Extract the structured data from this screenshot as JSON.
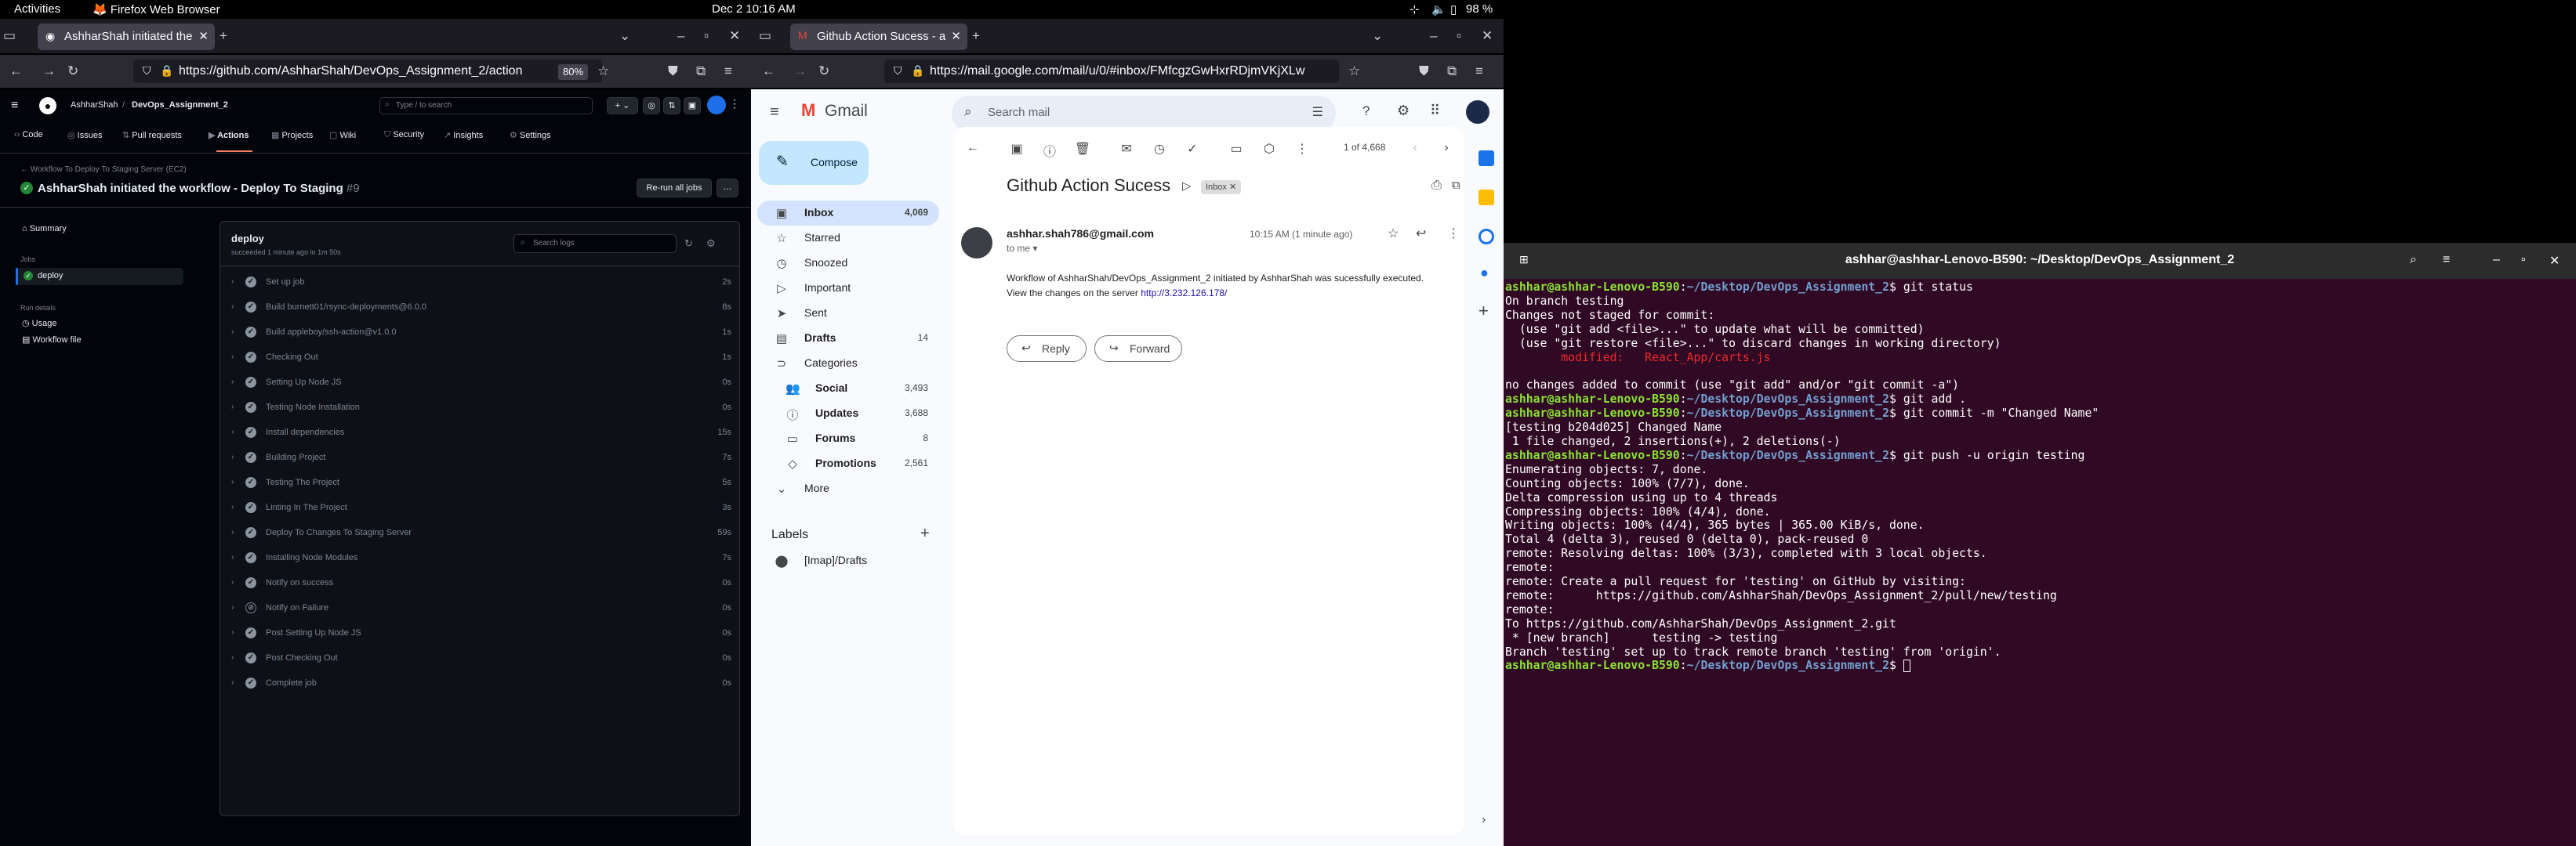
{
  "topbar": {
    "activities": "Activities",
    "app": "Firefox Web Browser",
    "clock": "Dec 2  10:16 AM",
    "battery": "98 %"
  },
  "win1": {
    "tab_title": "AshharShah initiated the",
    "url": "https://github.com/AshharShah/DevOps_Assignment_2/action",
    "zoom": "80%"
  },
  "win2": {
    "tab_title": "Github Action Sucess - a",
    "url": "https://mail.google.com/mail/u/0/#inbox/FMfcgzGwHxrRDjmVKjXLw"
  },
  "github": {
    "owner": "AshharShah",
    "repo": "DevOps_Assignment_2",
    "search_placeholder": "Type / to search",
    "tabs": [
      "Code",
      "Issues",
      "Pull requests",
      "Actions",
      "Projects",
      "Wiki",
      "Security",
      "Insights",
      "Settings"
    ],
    "breadcrumb": "Workflow To Deploy To Staging Server (EC2)",
    "run_title": "AshharShah initiated the workflow - Deploy To Staging",
    "run_number": "#9",
    "rerun": "Re-run all jobs",
    "summary": "Summary",
    "jobs_heading": "Jobs",
    "job": "deploy",
    "run_details": "Run details",
    "usage": "Usage",
    "workflow_file": "Workflow file",
    "panel_title": "deploy",
    "panel_sub": "succeeded 1 minute ago in 1m 50s",
    "search_logs": "Search logs",
    "steps": [
      {
        "name": "Set up job",
        "dur": "2s",
        "skip": false
      },
      {
        "name": "Build burnett01/rsync-deployments@6.0.0",
        "dur": "8s",
        "skip": false
      },
      {
        "name": "Build appleboy/ssh-action@v1.0.0",
        "dur": "1s",
        "skip": false
      },
      {
        "name": "Checking Out",
        "dur": "1s",
        "skip": false
      },
      {
        "name": "Setting Up Node JS",
        "dur": "0s",
        "skip": false
      },
      {
        "name": "Testing Node Installation",
        "dur": "0s",
        "skip": false
      },
      {
        "name": "Install dependencies",
        "dur": "15s",
        "skip": false
      },
      {
        "name": "Building Project",
        "dur": "7s",
        "skip": false
      },
      {
        "name": "Testing The Project",
        "dur": "5s",
        "skip": false
      },
      {
        "name": "Linting In The Project",
        "dur": "3s",
        "skip": false
      },
      {
        "name": "Deploy To Changes To Staging Server",
        "dur": "59s",
        "skip": false
      },
      {
        "name": "Installing Node Modules",
        "dur": "7s",
        "skip": false
      },
      {
        "name": "Notify on success",
        "dur": "0s",
        "skip": false
      },
      {
        "name": "Notify on Failure",
        "dur": "0s",
        "skip": true
      },
      {
        "name": "Post Setting Up Node JS",
        "dur": "0s",
        "skip": false
      },
      {
        "name": "Post Checking Out",
        "dur": "0s",
        "skip": false
      },
      {
        "name": "Complete job",
        "dur": "0s",
        "skip": false
      }
    ]
  },
  "gmail": {
    "brand": "Gmail",
    "search_placeholder": "Search mail",
    "compose": "Compose",
    "nav": [
      {
        "label": "Inbox",
        "count": "4,069",
        "icon": "▣",
        "bold": true
      },
      {
        "label": "Starred",
        "count": "",
        "icon": "☆",
        "bold": false
      },
      {
        "label": "Snoozed",
        "count": "",
        "icon": "◷",
        "bold": false
      },
      {
        "label": "Important",
        "count": "",
        "icon": "▷",
        "bold": false
      },
      {
        "label": "Sent",
        "count": "",
        "icon": "➤",
        "bold": false
      },
      {
        "label": "Drafts",
        "count": "14",
        "icon": "▤",
        "bold": true
      },
      {
        "label": "Categories",
        "count": "",
        "icon": "⊃",
        "bold": false
      },
      {
        "label": "Social",
        "count": "3,493",
        "icon": "👥",
        "bold": true
      },
      {
        "label": "Updates",
        "count": "3,688",
        "icon": "ⓘ",
        "bold": true
      },
      {
        "label": "Forums",
        "count": "8",
        "icon": "▭",
        "bold": true
      },
      {
        "label": "Promotions",
        "count": "2,561",
        "icon": "◇",
        "bold": true
      },
      {
        "label": "More",
        "count": "",
        "icon": "⌄",
        "bold": false
      }
    ],
    "labels_heading": "Labels",
    "label_item": "[Imap]/Drafts",
    "pager": "1 of 4,668",
    "subject": "Github Action Sucess",
    "inbox_chip": "Inbox",
    "sender": "ashhar.shah786@gmail.com",
    "to": "to me",
    "time": "10:15 AM (1 minute ago)",
    "body": "Workflow of AshharShah/DevOps_Assignment_2 initiated by AshharShah was sucessfully executed. View the changes on the server",
    "link": "http://3.232.126.178/",
    "reply": "Reply",
    "forward": "Forward"
  },
  "terminal": {
    "title": "ashhar@ashhar-Lenovo-B590: ~/Desktop/DevOps_Assignment_2",
    "user": "ashhar@ashhar-Lenovo-B590",
    "path": "~/Desktop/DevOps_Assignment_2",
    "cmd1": "git status",
    "out1": "On branch testing\nChanges not staged for commit:\n  (use \"git add <file>...\" to update what will be committed)\n  (use \"git restore <file>...\" to discard changes in working directory)",
    "modified": "        modified:   React_App/carts.js",
    "out1b": "\nno changes added to commit (use \"git add\" and/or \"git commit -a\")",
    "cmd2": "git add .",
    "cmd3": "git commit -m \"Changed Name\"",
    "out3": "[testing b204d025] Changed Name\n 1 file changed, 2 insertions(+), 2 deletions(-)",
    "cmd4": "git push -u origin testing",
    "out4": "Enumerating objects: 7, done.\nCounting objects: 100% (7/7), done.\nDelta compression using up to 4 threads\nCompressing objects: 100% (4/4), done.\nWriting objects: 100% (4/4), 365 bytes | 365.00 KiB/s, done.\nTotal 4 (delta 3), reused 0 (delta 0), pack-reused 0\nremote: Resolving deltas: 100% (3/3), completed with 3 local objects.\nremote:\nremote: Create a pull request for 'testing' on GitHub by visiting:\nremote:      https://github.com/AshharShah/DevOps_Assignment_2/pull/new/testing\nremote:\nTo https://github.com/AshharShah/DevOps_Assignment_2.git\n * [new branch]      testing -> testing\nBranch 'testing' set up to track remote branch 'testing' from 'origin'."
  }
}
